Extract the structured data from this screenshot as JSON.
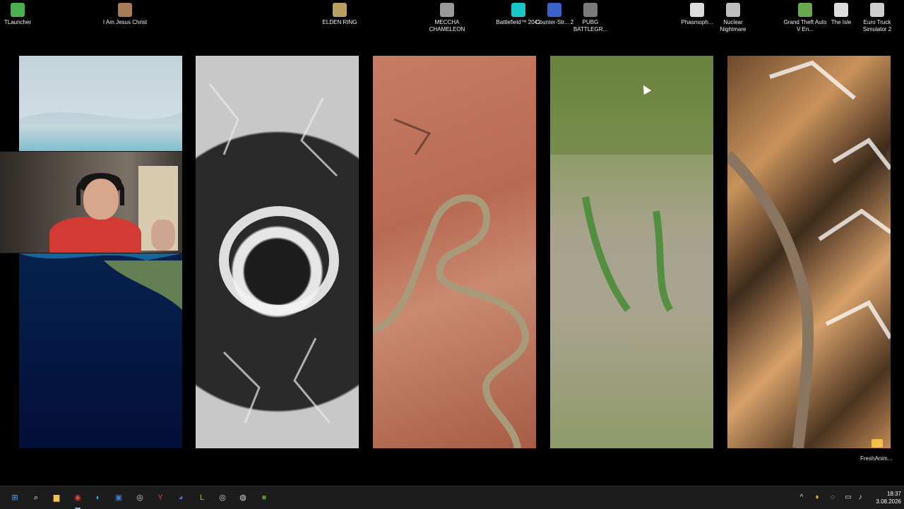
{
  "desktop_icons": [
    {
      "label": "TLauncher",
      "icon": "tlauncher-icon",
      "color": "#4caf50"
    },
    {
      "label": "I Am Jesus Christ",
      "icon": "jesus-game-icon",
      "color": "#a87b5a"
    },
    {
      "label": "ELDEN RING",
      "icon": "elden-ring-icon",
      "color": "#b8a060"
    },
    {
      "label": "MECCHA CHAMELEON",
      "icon": "chameleon-icon",
      "color": "#9a9a9a"
    },
    {
      "label": "Battlefield™ 2042",
      "icon": "battlefield-icon",
      "color": "#18c8c8"
    },
    {
      "label": "Counter-Str... 2",
      "icon": "counter-strike-icon",
      "color": "#3a62c8"
    },
    {
      "label": "PUBG BATTLEGR...",
      "icon": "pubg-icon",
      "color": "#7a7a7a"
    },
    {
      "label": "Phasmoph...",
      "icon": "phasmophobia-icon",
      "color": "#dcdcdc"
    },
    {
      "label": "Nuclear Nightmare",
      "icon": "nuclear-nightmare-icon",
      "color": "#bfbfbf"
    },
    {
      "label": "Grand Theft Auto V En...",
      "icon": "gta-icon",
      "color": "#6aa84f"
    },
    {
      "label": "The Isle",
      "icon": "the-isle-icon",
      "color": "#dddddd"
    },
    {
      "label": "Euro Truck Simulator 2",
      "icon": "euro-truck-icon",
      "color": "#cfcfcf"
    }
  ],
  "panels": [
    {
      "name": "satellite-coast-ocean"
    },
    {
      "name": "satellite-crater-snow"
    },
    {
      "name": "satellite-river-canyon"
    },
    {
      "name": "satellite-green-plains"
    },
    {
      "name": "satellite-mountains"
    }
  ],
  "desktop_file": {
    "label": "FreshAnim..."
  },
  "taskbar": {
    "apps": [
      {
        "name": "start-button",
        "icon": "windows-icon",
        "glyph": "⊞",
        "color": "#4aa3ff"
      },
      {
        "name": "search-button",
        "icon": "search-icon",
        "glyph": "⌕",
        "color": "#ffffff"
      },
      {
        "name": "file-explorer",
        "icon": "folder-icon",
        "glyph": "▆",
        "color": "#f3c24a"
      },
      {
        "name": "chrome",
        "icon": "chrome-icon",
        "glyph": "◉",
        "color": "#e94235"
      },
      {
        "name": "edge",
        "icon": "edge-icon",
        "glyph": "◐",
        "color": "#2fb3e6"
      },
      {
        "name": "ms-store",
        "icon": "store-icon",
        "glyph": "▣",
        "color": "#3a7bd5"
      },
      {
        "name": "steam",
        "icon": "steam-icon",
        "glyph": "◎",
        "color": "#c7d5e0"
      },
      {
        "name": "yandex",
        "icon": "yandex-icon",
        "glyph": "Y",
        "color": "#e53935"
      },
      {
        "name": "discord",
        "icon": "discord-icon",
        "glyph": "◕",
        "color": "#5865f2"
      },
      {
        "name": "live-app",
        "icon": "live-icon",
        "glyph": "L",
        "color": "#8bc34a"
      },
      {
        "name": "steam-2",
        "icon": "steam-icon",
        "glyph": "◎",
        "color": "#c7d5e0"
      },
      {
        "name": "obs",
        "icon": "obs-icon",
        "glyph": "◍",
        "color": "#d6d6d6"
      },
      {
        "name": "minecraft",
        "icon": "minecraft-icon",
        "glyph": "■",
        "color": "#5d8a3a"
      }
    ],
    "clock": {
      "time": "18:37",
      "date": "3.08.2026"
    }
  }
}
